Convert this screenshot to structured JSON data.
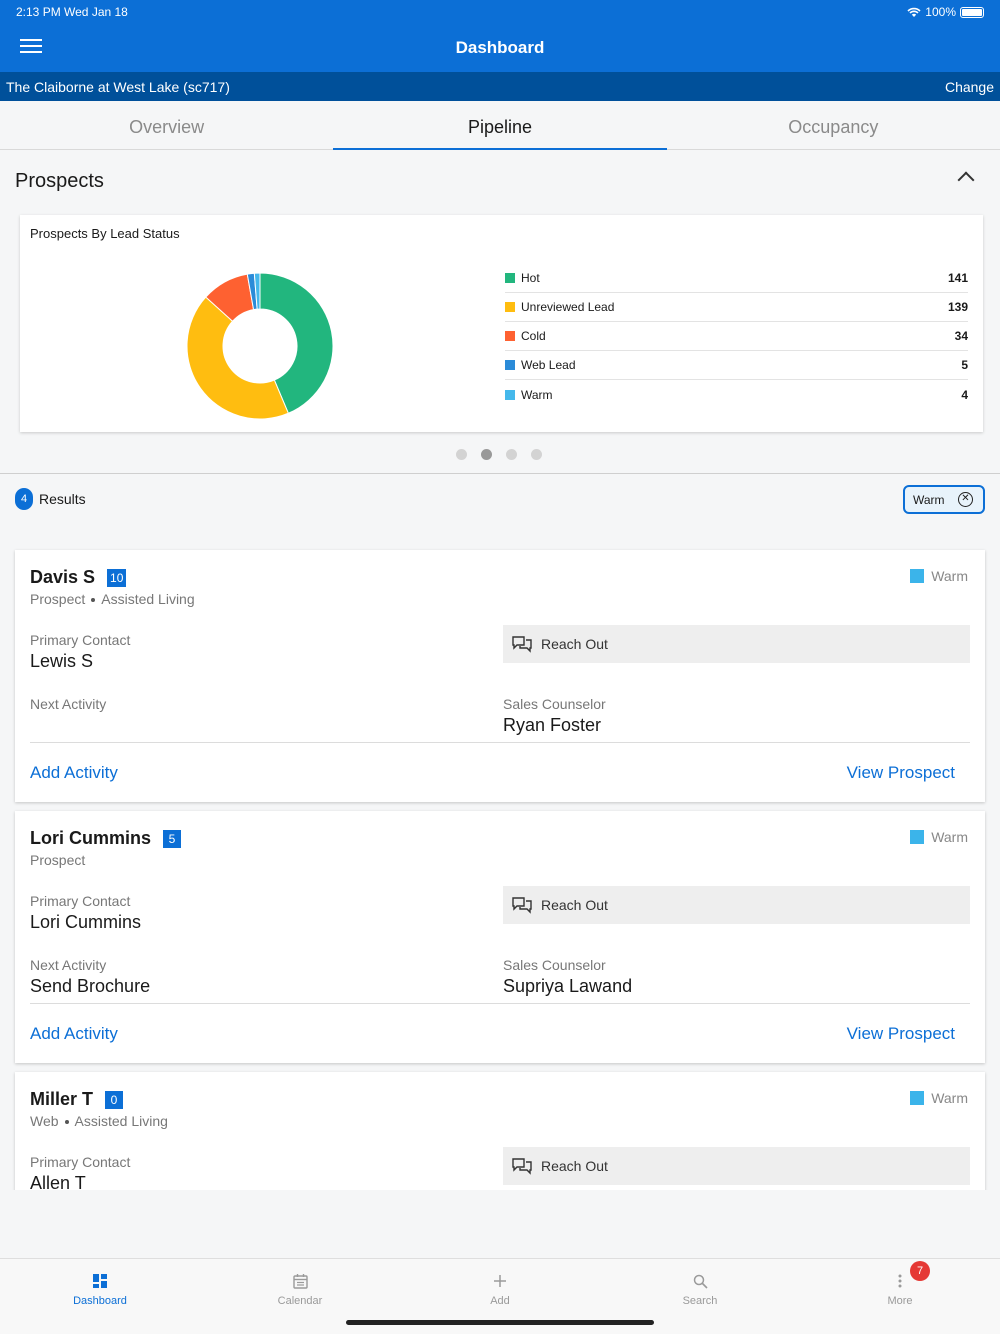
{
  "statusbar": {
    "time": "2:13 PM  Wed Jan 18",
    "battery": "100%"
  },
  "appbar": {
    "title": "Dashboard"
  },
  "community": {
    "name": "The Claiborne at West Lake (sc717)",
    "change_label": "Change"
  },
  "tabs": [
    {
      "label": "Overview"
    },
    {
      "label": "Pipeline",
      "active": true
    },
    {
      "label": "Occupancy"
    }
  ],
  "prospects": {
    "title": "Prospects",
    "chart_title": "Prospects By Lead Status"
  },
  "chart_data": {
    "type": "pie",
    "donut": true,
    "title": "Prospects By Lead Status",
    "categories": [
      "Hot",
      "Unreviewed Lead",
      "Cold",
      "Web Lead",
      "Warm"
    ],
    "values": [
      141,
      139,
      34,
      5,
      4
    ],
    "colors": [
      "#22b67e",
      "#ffbd10",
      "#fe6131",
      "#2b8bd8",
      "#45b8eb"
    ],
    "legend": "right"
  },
  "carousel": {
    "pages": 4,
    "active_index": 1
  },
  "results": {
    "count": "4",
    "label": "Results",
    "filter": "Warm"
  },
  "prospect_cards": [
    {
      "name": "Davis S",
      "num": "10",
      "type": "Prospect",
      "care": "Assisted Living",
      "status": "Warm",
      "primary_contact_label": "Primary Contact",
      "primary_contact": "Lewis S",
      "reach_out": "Reach Out",
      "next_activity_label": "Next Activity",
      "next_activity": "",
      "sales_counselor_label": "Sales Counselor",
      "sales_counselor": "Ryan Foster",
      "add_activity": "Add Activity",
      "view_prospect": "View Prospect"
    },
    {
      "name": "Lori Cummins",
      "num": "5",
      "type": "Prospect",
      "care": "",
      "status": "Warm",
      "primary_contact_label": "Primary Contact",
      "primary_contact": "Lori Cummins",
      "reach_out": "Reach Out",
      "next_activity_label": "Next Activity",
      "next_activity": "Send Brochure",
      "sales_counselor_label": "Sales Counselor",
      "sales_counselor": "Supriya Lawand",
      "add_activity": "Add Activity",
      "view_prospect": "View Prospect"
    },
    {
      "name": "Miller T",
      "num": "0",
      "type": "Web",
      "care": "Assisted Living",
      "status": "Warm",
      "primary_contact_label": "Primary Contact",
      "primary_contact": "Allen T",
      "reach_out": "Reach Out"
    }
  ],
  "tabbar": [
    {
      "label": "Dashboard",
      "icon": "dashboard-icon",
      "active": true
    },
    {
      "label": "Calendar",
      "icon": "calendar-icon"
    },
    {
      "label": "Add",
      "icon": "plus-icon"
    },
    {
      "label": "Search",
      "icon": "search-icon"
    },
    {
      "label": "More",
      "icon": "more-icon",
      "badge": "7"
    }
  ]
}
